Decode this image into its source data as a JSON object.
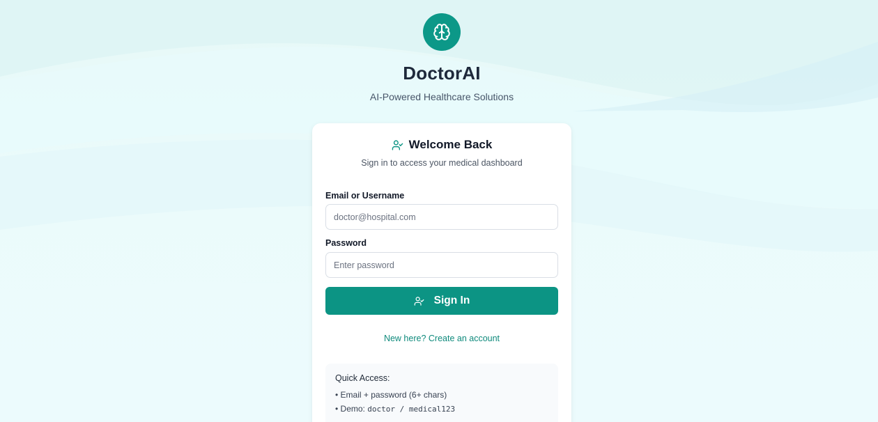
{
  "brand": {
    "logo_icon": "brain-icon",
    "title": "DoctorAI",
    "subtitle": "AI-Powered Healthcare Solutions"
  },
  "login": {
    "header_icon": "user-check-icon",
    "title": "Welcome Back",
    "subtitle": "Sign in to access your medical dashboard",
    "email": {
      "label": "Email or Username",
      "placeholder": "doctor@hospital.com",
      "value": ""
    },
    "password": {
      "label": "Password",
      "placeholder": "Enter password",
      "value": ""
    },
    "submit": {
      "icon": "user-check-icon",
      "label": "Sign In"
    },
    "create_account_link": "New here? Create an account"
  },
  "quick_access": {
    "title": "Quick Access:",
    "bullet": "•",
    "item1": "Email + password (6+ chars)",
    "item2_prefix": "Demo:",
    "item2_code": "doctor / medical123"
  },
  "colors": {
    "primary": "#0c9484",
    "link": "#0f8a7c",
    "title_text": "#1e293b",
    "background": "#e8f9f8"
  }
}
